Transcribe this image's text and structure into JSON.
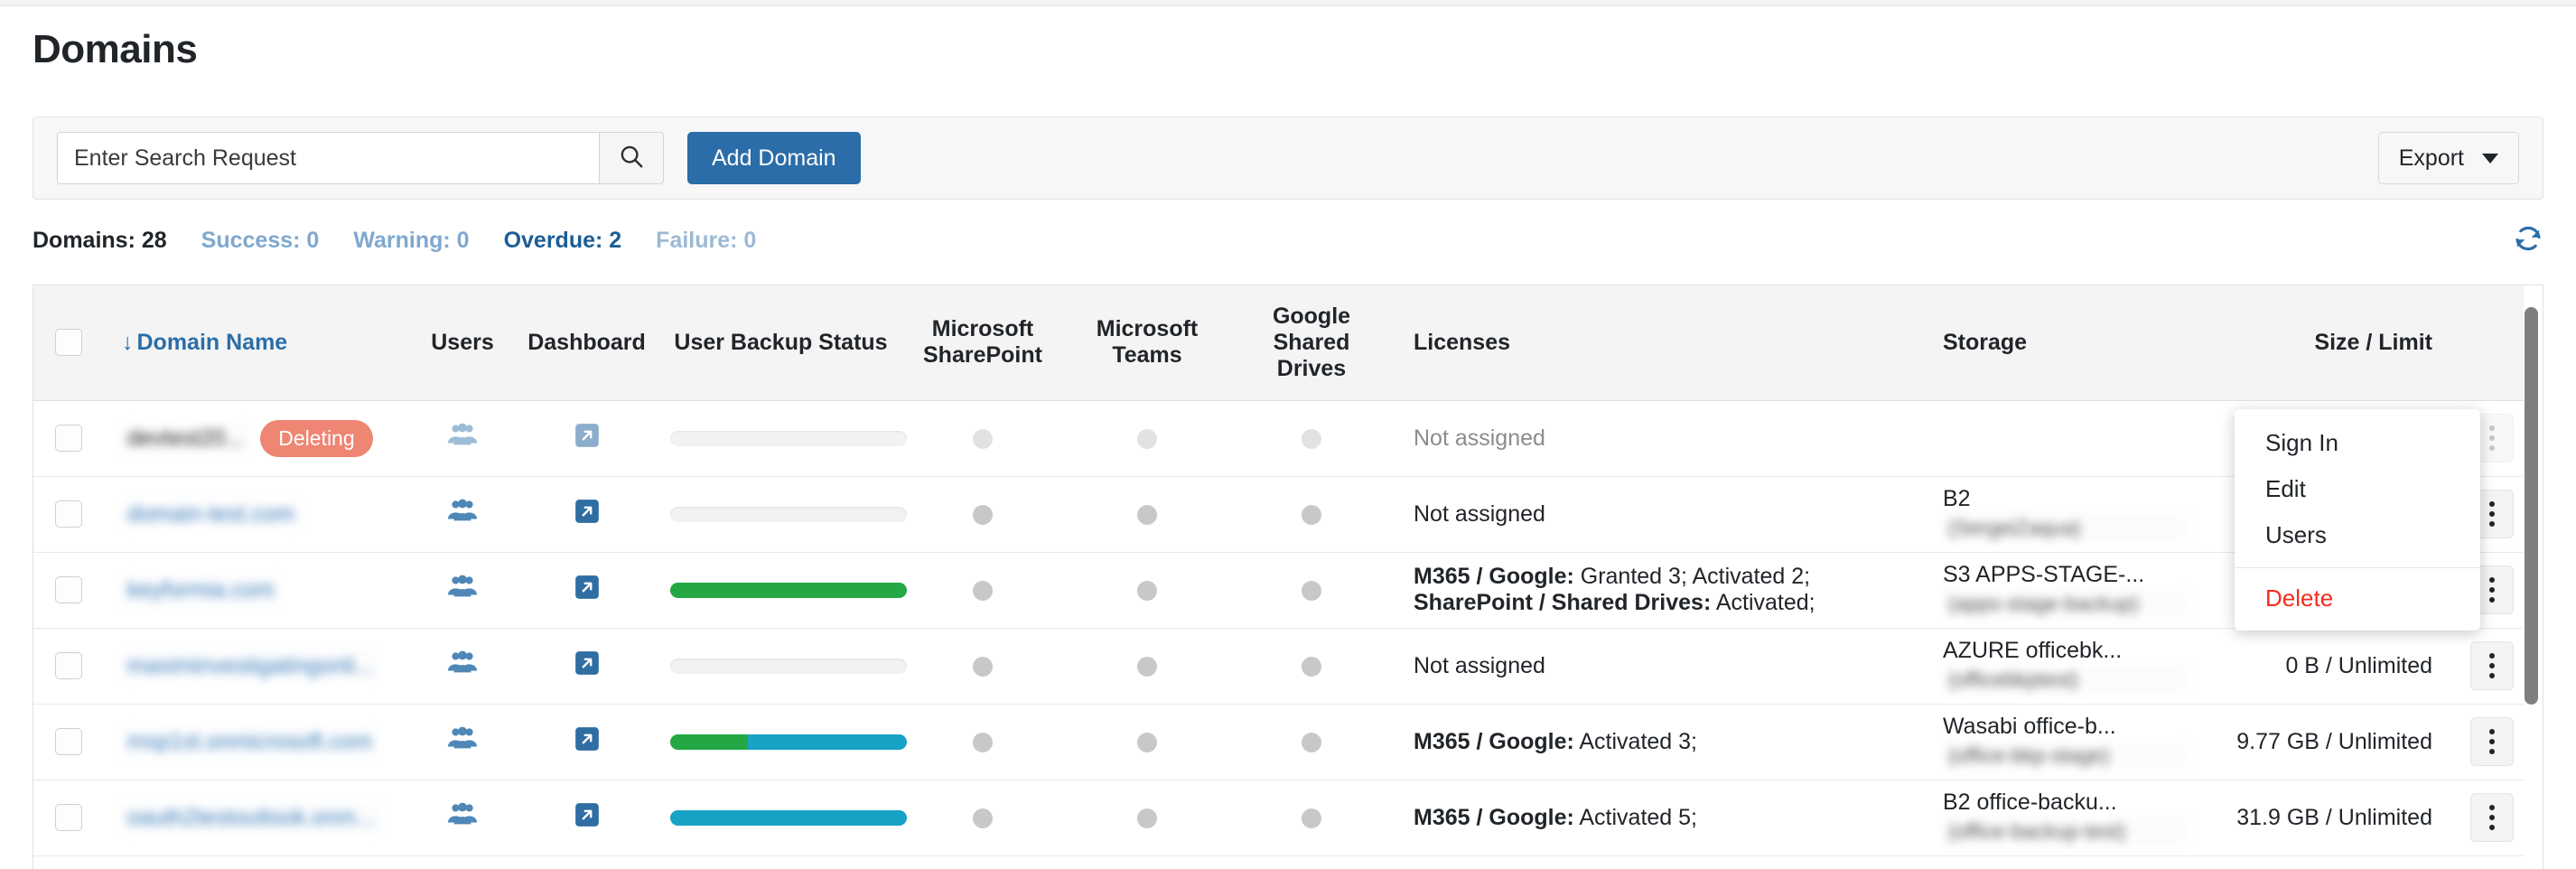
{
  "page": {
    "title": "Domains"
  },
  "toolbar": {
    "search_placeholder": "Enter Search Request",
    "search_value": "",
    "search_icon": "search-icon",
    "add_domain_label": "Add Domain",
    "export_label": "Export"
  },
  "status": {
    "total": "Domains: 28",
    "success": "Success: 0",
    "warning": "Warning: 0",
    "overdue": "Overdue: 2",
    "failure": "Failure: 0",
    "refresh_icon": "refresh-icon"
  },
  "table": {
    "sort_arrow": "↓",
    "columns": [
      {
        "key": "select",
        "label": ""
      },
      {
        "key": "domain",
        "label": "Domain Name"
      },
      {
        "key": "users",
        "label": "Users"
      },
      {
        "key": "dashboard",
        "label": "Dashboard"
      },
      {
        "key": "backup",
        "label": "User Backup Status"
      },
      {
        "key": "sharepoint",
        "label": "Microsoft SharePoint"
      },
      {
        "key": "teams",
        "label": "Microsoft Teams"
      },
      {
        "key": "drives",
        "label": "Google Shared Drives"
      },
      {
        "key": "licenses",
        "label": "Licenses"
      },
      {
        "key": "storage",
        "label": "Storage"
      },
      {
        "key": "size",
        "label": "Size / Limit"
      },
      {
        "key": "actions",
        "label": ""
      }
    ],
    "rows": [
      {
        "domain": "devtest20...",
        "domain_redacted": true,
        "badge": "Deleting",
        "muted": true,
        "backup_segments": [],
        "licenses_prefix": "",
        "licenses_text": "Not assigned",
        "licenses_muted": true,
        "licenses_line2_prefix": "",
        "licenses_line2_text": "",
        "storage_name": "",
        "storage_sub": "",
        "size": ""
      },
      {
        "domain": "domain-test.com",
        "domain_redacted": true,
        "badge": "",
        "muted": false,
        "backup_segments": [],
        "licenses_prefix": "",
        "licenses_text": "Not assigned",
        "licenses_muted": false,
        "licenses_line2_prefix": "",
        "licenses_line2_text": "",
        "storage_name": "B2",
        "storage_sub": "(SergeiZaqua)",
        "size": ""
      },
      {
        "domain": "keyformia.com",
        "domain_redacted": true,
        "badge": "",
        "muted": false,
        "backup_segments": [
          {
            "color": "green",
            "pct": 100
          }
        ],
        "licenses_prefix": "M365 / Google:",
        "licenses_text": " Granted 3; Activated 2;",
        "licenses_muted": false,
        "licenses_line2_prefix": "SharePoint / Shared Drives:",
        "licenses_line2_text": " Activated;",
        "storage_name": "S3 APPS-STAGE-...",
        "storage_sub": "(apps-stage-backup)",
        "size": ""
      },
      {
        "domain": "maximinvestigatingonli...",
        "domain_redacted": true,
        "badge": "",
        "muted": false,
        "backup_segments": [],
        "licenses_prefix": "",
        "licenses_text": "Not assigned",
        "licenses_muted": false,
        "licenses_line2_prefix": "",
        "licenses_line2_text": "",
        "storage_name": "AZURE officebk...",
        "storage_sub": "(officebkptest)",
        "size": "0 B / Unlimited"
      },
      {
        "domain": "msp1st.onmicrosoft.com",
        "domain_redacted": true,
        "badge": "",
        "muted": false,
        "backup_segments": [
          {
            "color": "green",
            "pct": 33
          },
          {
            "color": "blue",
            "pct": 67
          }
        ],
        "licenses_prefix": "M365 / Google:",
        "licenses_text": " Activated 3;",
        "licenses_muted": false,
        "licenses_line2_prefix": "",
        "licenses_line2_text": "",
        "storage_name": "Wasabi office-b...",
        "storage_sub": "(office-bkp-stage)",
        "size": "9.77 GB / Unlimited"
      },
      {
        "domain": "oauth2testoutlook.onm...",
        "domain_redacted": true,
        "badge": "",
        "muted": false,
        "backup_segments": [
          {
            "color": "blue",
            "pct": 100
          }
        ],
        "licenses_prefix": "M365 / Google:",
        "licenses_text": " Activated 5;",
        "licenses_muted": false,
        "licenses_line2_prefix": "",
        "licenses_line2_text": "",
        "storage_name": "B2 office-backu...",
        "storage_sub": "(office-backup-test)",
        "size": "31.9 GB / Unlimited"
      }
    ]
  },
  "context_menu": {
    "items": [
      {
        "label": "Sign In",
        "danger": false
      },
      {
        "label": "Edit",
        "danger": false
      },
      {
        "label": "Users",
        "danger": false
      },
      {
        "label": "Delete",
        "danger": true
      }
    ]
  },
  "colors": {
    "primary": "#2b6da8",
    "link": "#2b6da8",
    "danger": "#f42c1e",
    "badge_deleting": "#ef8573",
    "progress_green": "#23a845",
    "progress_blue": "#17a2c6"
  }
}
